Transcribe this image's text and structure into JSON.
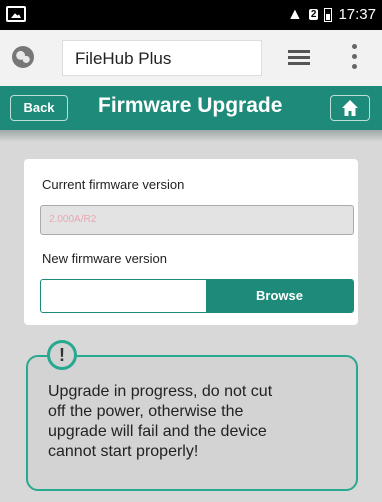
{
  "status_bar": {
    "time": "17:37",
    "sim_badge": "2"
  },
  "browser": {
    "url_title": "FileHub Plus"
  },
  "header": {
    "back_label": "Back",
    "title": "Firmware Upgrade"
  },
  "form": {
    "current_label": "Current firmware version",
    "current_value": "2.000A/R2",
    "new_label": "New firmware version",
    "browse_label": "Browse"
  },
  "warning": {
    "icon_glyph": "!",
    "lines": [
      "Upgrade in progress, do not cut",
      "off the power, otherwise the",
      "upgrade will fail and the device",
      "cannot start properly!"
    ]
  },
  "colors": {
    "accent": "#1e8a7a",
    "warning_border": "#27a891"
  }
}
